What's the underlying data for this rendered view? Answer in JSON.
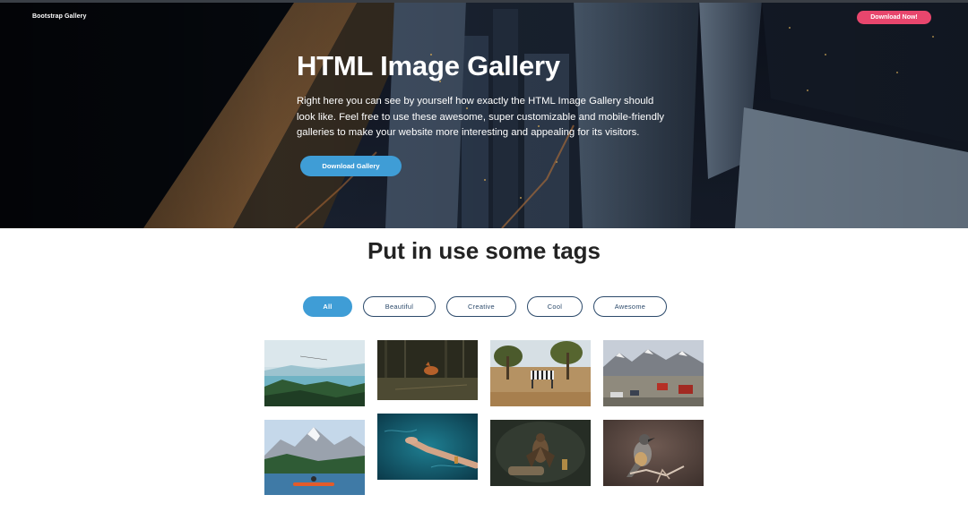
{
  "header": {
    "brand": "Bootstrap Gallery",
    "cta_label": "Download Now!"
  },
  "hero": {
    "title": "HTML Image Gallery",
    "description": "Right here you can see by yourself how exactly the HTML Image Gallery should look like. Feel free to use these awesome, super customizable and mobile-friendly galleries to make your website more interesting and appealing for its visitors.",
    "button_label": "Download Gallery"
  },
  "tags_section": {
    "title": "Put in use some tags",
    "tags": [
      "All",
      "Beautiful",
      "Creative",
      "Cool",
      "Awesome"
    ],
    "active_tag": "All"
  },
  "gallery": {
    "images": [
      {
        "subject": "lake-mountains"
      },
      {
        "subject": "fox-in-forest"
      },
      {
        "subject": "zebra-savanna"
      },
      {
        "subject": "snowy-village"
      },
      {
        "subject": "kayak-mountains"
      },
      {
        "subject": "hand-in-water"
      },
      {
        "subject": "falcon-on-glove"
      },
      {
        "subject": "bird-on-branch"
      }
    ]
  },
  "colors": {
    "accent_blue": "#3f9dd6",
    "accent_pink": "#e8466d",
    "tag_border": "#2c4a6b",
    "heading": "#232323"
  }
}
